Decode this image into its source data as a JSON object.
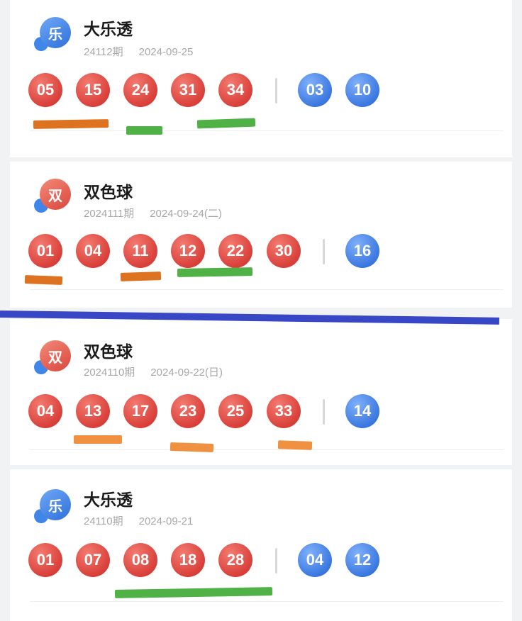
{
  "draws": [
    {
      "lottery": "大乐透",
      "icon_char": "乐",
      "issue": "24112期",
      "date": "2024-09-25",
      "red_balls": [
        "05",
        "15",
        "24",
        "31",
        "34"
      ],
      "blue_balls": [
        "03",
        "10"
      ]
    },
    {
      "lottery": "双色球",
      "icon_char": "双",
      "issue": "2024111期",
      "date": "2024-09-24(二)",
      "red_balls": [
        "01",
        "04",
        "11",
        "12",
        "22",
        "30"
      ],
      "blue_balls": [
        "16"
      ]
    },
    {
      "lottery": "双色球",
      "icon_char": "双",
      "issue": "2024110期",
      "date": "2024-09-22(日)",
      "red_balls": [
        "04",
        "13",
        "17",
        "23",
        "25",
        "33"
      ],
      "blue_balls": [
        "14"
      ]
    },
    {
      "lottery": "大乐透",
      "icon_char": "乐",
      "issue": "24110期",
      "date": "2024-09-21",
      "red_balls": [
        "01",
        "07",
        "08",
        "18",
        "28"
      ],
      "blue_balls": [
        "04",
        "12"
      ]
    }
  ],
  "colors": {
    "red_ball": "#d9403a",
    "blue_ball": "#3b78e0",
    "orange_mark": "#dd7320",
    "green_mark": "#4fb146",
    "divider_line": "#3747c6"
  },
  "icons": {
    "dlt": "dlt-logo-icon",
    "ssq": "ssq-logo-icon"
  }
}
